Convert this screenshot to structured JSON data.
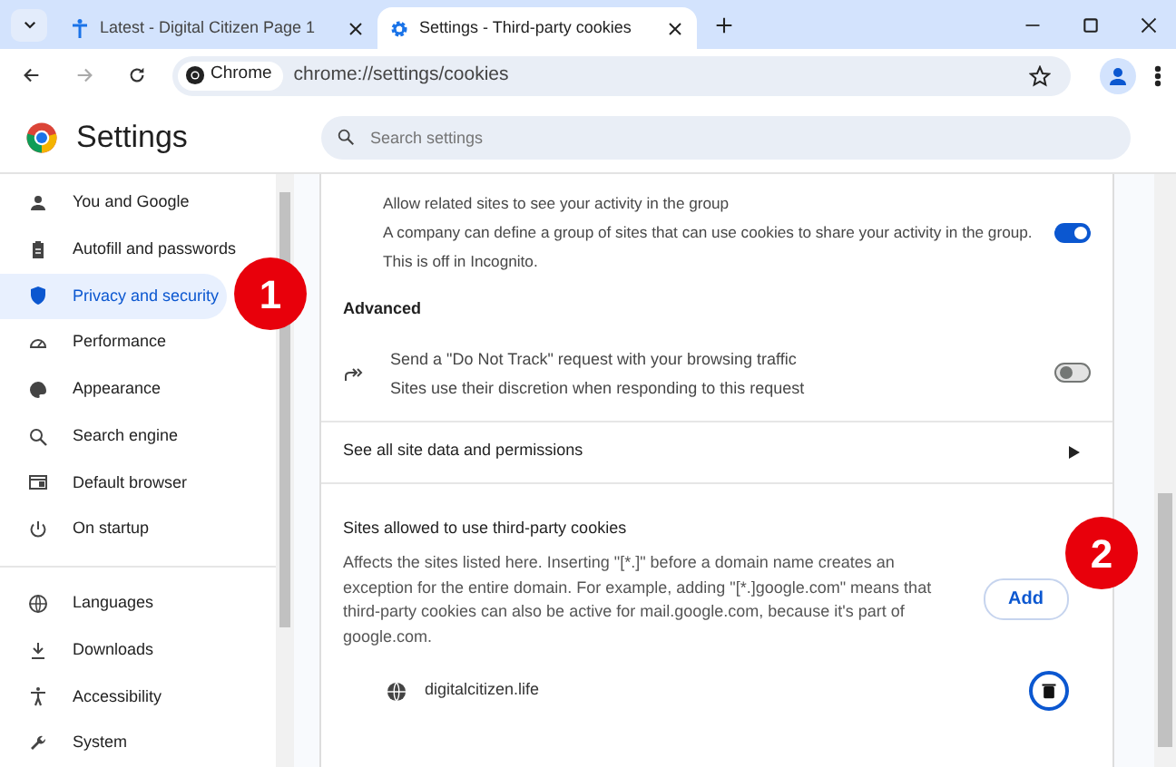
{
  "tabs": [
    {
      "title": "Latest - Digital Citizen Page 1",
      "selected": false
    },
    {
      "title": "Settings - Third-party cookies",
      "selected": true
    }
  ],
  "address_bar": {
    "chip": "Chrome",
    "url": "chrome://settings/cookies"
  },
  "header": {
    "title": "Settings",
    "search_placeholder": "Search settings"
  },
  "sidebar": {
    "groups": [
      [
        {
          "label": "You and Google",
          "selected": false
        },
        {
          "label": "Autofill and passwords",
          "selected": false
        },
        {
          "label": "Privacy and security",
          "selected": true
        },
        {
          "label": "Performance",
          "selected": false
        },
        {
          "label": "Appearance",
          "selected": false
        },
        {
          "label": "Search engine",
          "selected": false
        },
        {
          "label": "Default browser",
          "selected": false
        },
        {
          "label": "On startup",
          "selected": false
        }
      ],
      [
        {
          "label": "Languages",
          "selected": false
        },
        {
          "label": "Downloads",
          "selected": false
        },
        {
          "label": "Accessibility",
          "selected": false
        },
        {
          "label": "System",
          "selected": false
        }
      ]
    ]
  },
  "content": [
    {
      "kind": "subtoggle",
      "title": "Allow related sites to see your activity in the group",
      "description": [
        "A company can define a group of sites that can use cookies to share your activity in the group.",
        "This is off in Incognito."
      ],
      "on": true
    },
    {
      "kind": "heading",
      "title": "Advanced"
    },
    {
      "kind": "toggle",
      "title": "Send a \"Do Not Track\" request with your browsing traffic",
      "description": [
        "Sites use their discretion when responding to this request"
      ],
      "on": false
    },
    {
      "kind": "link",
      "title": "See all site data and permissions"
    },
    {
      "kind": "section",
      "title": "Sites allowed to use third-party cookies",
      "description": "Affects the sites listed here. Inserting \"[*.]\" before a domain name creates an exception for the entire domain. For example, adding \"[*.]google.com\" means that third-party cookies can also be active for mail.google.com, because it's part of google.com.",
      "button": "Add"
    },
    {
      "kind": "site",
      "title": "digitalcitizen.life"
    }
  ],
  "annotations": [
    {
      "label": "1"
    },
    {
      "label": "2"
    }
  ]
}
